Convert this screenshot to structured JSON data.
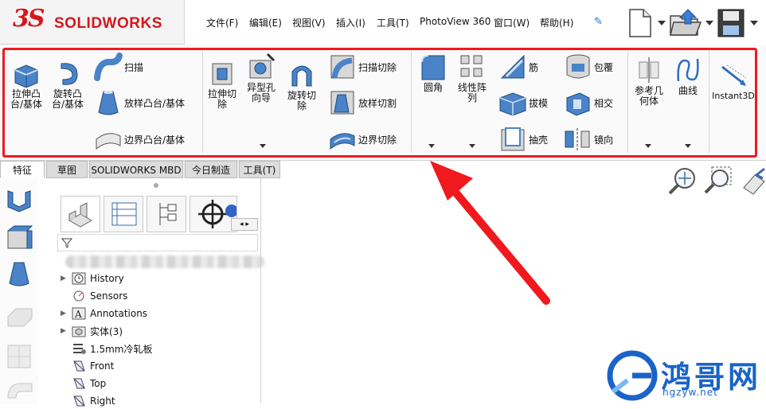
{
  "app": {
    "brand": "SOLIDWORKS",
    "brand_mark": "3S"
  },
  "menu": {
    "items": [
      {
        "label": "文件(F)"
      },
      {
        "label": "编辑(E)"
      },
      {
        "label": "视图(V)"
      },
      {
        "label": "插入(I)"
      },
      {
        "label": "工具(T)"
      },
      {
        "label": "PhotoView 360"
      },
      {
        "label": "窗口(W)"
      },
      {
        "label": "帮助(H)"
      }
    ],
    "pin_icon": "pin-icon"
  },
  "quick_access": {
    "icons": [
      "new-document-icon",
      "open-folder-icon",
      "save-icon"
    ]
  },
  "ribbon": {
    "highlight_color": "#f0191e",
    "buttons": {
      "extrude_boss": "拉伸凸台/基体",
      "revolve_boss": "旋转凸台/基体",
      "sweep": "扫描",
      "loft_boss": "放样凸台/基体",
      "boundary_boss": "边界凸台/基体",
      "extrude_cut": "拉伸切除",
      "hole_wizard": "异型孔向导",
      "revolve_cut": "旋转切除",
      "sweep_cut": "扫描切除",
      "loft_cut": "放样切割",
      "boundary_cut": "边界切除",
      "fillet": "圆角",
      "linear_pattern": "线性阵列",
      "rib": "筋",
      "draft": "拔模",
      "shell": "抽壳",
      "wrap": "包覆",
      "intersect": "相交",
      "mirror": "镜向",
      "reference_geometry": "参考几何体",
      "curves": "曲线",
      "instant3d": "Instant3D"
    }
  },
  "tabs": [
    {
      "label": "特征",
      "active": true
    },
    {
      "label": "草图",
      "active": false
    },
    {
      "label": "SOLIDWORKS MBD",
      "active": false
    },
    {
      "label": "今日制造",
      "active": false
    },
    {
      "label": "工具(T)",
      "active": false
    }
  ],
  "feature_tree": {
    "items": [
      {
        "label": "History",
        "icon": "history-icon",
        "expandable": true
      },
      {
        "label": "Sensors",
        "icon": "sensors-icon",
        "expandable": false
      },
      {
        "label": "Annotations",
        "icon": "annotations-icon",
        "expandable": true
      },
      {
        "label": "实体(3)",
        "icon": "solid-bodies-icon",
        "expandable": true
      },
      {
        "label": "1.5mm冷轧板",
        "icon": "material-icon",
        "expandable": false
      },
      {
        "label": "Front",
        "icon": "plane-icon",
        "expandable": false
      },
      {
        "label": "Top",
        "icon": "plane-icon",
        "expandable": false
      },
      {
        "label": "Right",
        "icon": "plane-icon",
        "expandable": false
      }
    ]
  },
  "watermark": {
    "title": "鸿哥网",
    "url": "hgzyw.net",
    "color": "#1a63c8"
  }
}
